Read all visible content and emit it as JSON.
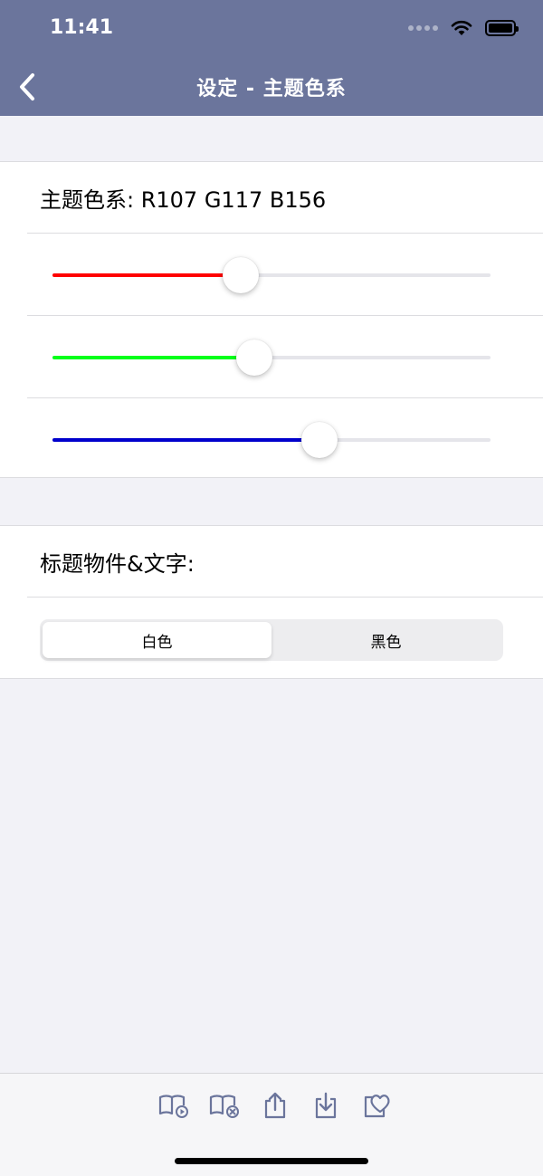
{
  "status_bar": {
    "time": "11:41"
  },
  "nav": {
    "title": "设定 - 主题色系"
  },
  "theme": {
    "title": "主题色系: R107 G117 B156",
    "sliders": [
      {
        "channel": "R",
        "color": "#ff0000",
        "value": 0.43
      },
      {
        "channel": "G",
        "color": "#00ff1a",
        "value": 0.46
      },
      {
        "channel": "B",
        "color": "#0000cc",
        "value": 0.61
      }
    ]
  },
  "title_style": {
    "label": "标题物件&文字:",
    "options": [
      "白色",
      "黑色"
    ],
    "selected": "白色"
  },
  "colors": {
    "nav_bg": "#6b759c",
    "toolbar_icon": "#6b759c"
  },
  "toolbar": {
    "icons": [
      "book-play-icon",
      "book-remove-icon",
      "share-upload-icon",
      "download-icon",
      "favorite-heart-icon"
    ]
  }
}
